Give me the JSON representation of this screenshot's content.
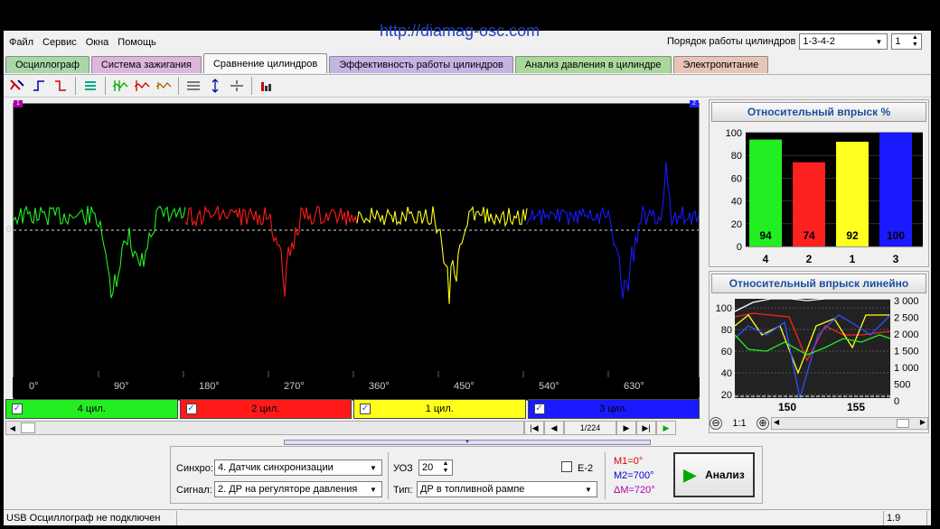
{
  "url_watermark": "http://diamag-osc.com",
  "menu": [
    "Файл",
    "Сервис",
    "Окна",
    "Помощь"
  ],
  "order": {
    "label": "Порядок работы цилиндров",
    "value": "1-3-4-2",
    "count": "1"
  },
  "tabs": [
    {
      "label": "Осциллограф",
      "color": "#a8d8a8"
    },
    {
      "label": "Система зажигания",
      "color": "#dcb6dc"
    },
    {
      "label": "Сравнение цилиндров",
      "color": "#f8f8f8"
    },
    {
      "label": "Эффективность работы цилиндров",
      "color": "#c4b4e4"
    },
    {
      "label": "Анализ давления в цилиндре",
      "color": "#a8d89c"
    },
    {
      "label": "Электропитание",
      "color": "#e8c4b4"
    }
  ],
  "scope": {
    "zero_label": "0",
    "x_ticks": [
      "0°",
      "90°",
      "180°",
      "270°",
      "360°",
      "450°",
      "540°",
      "630°"
    ],
    "marker1": "1",
    "marker2": "2"
  },
  "cylinders": [
    {
      "label": "4 цил.",
      "color": "#22ee22",
      "text_color": "#000"
    },
    {
      "label": "2 цил.",
      "color": "#ff1a1a",
      "text_color": "#000"
    },
    {
      "label": "1 цил.",
      "color": "#ffff1a",
      "text_color": "#000"
    },
    {
      "label": "3 цил.",
      "color": "#1a1aff",
      "text_color": "#000"
    }
  ],
  "nav": {
    "page": "1/224"
  },
  "relative_injection": {
    "title": "Относительный впрыск %",
    "y_ticks": [
      "100",
      "80",
      "60",
      "40",
      "20",
      "0"
    ],
    "chart_data": {
      "type": "bar",
      "categories": [
        "4",
        "2",
        "1",
        "3"
      ],
      "values": [
        94,
        74,
        92,
        100
      ],
      "colors": [
        "#22ee22",
        "#ff2020",
        "#ffff20",
        "#1a1aff"
      ],
      "ylim": [
        0,
        100
      ]
    }
  },
  "linear_injection": {
    "title": "Относительный впрыск линейно",
    "y_left": [
      "100",
      "80",
      "60",
      "40",
      "20"
    ],
    "y_right": [
      "3 000",
      "2 500",
      "2 000",
      "1 500",
      "1 000",
      "500",
      "0"
    ],
    "x_ticks": [
      "150",
      "155"
    ],
    "zoom": "1:1"
  },
  "controls": {
    "sync_label": "Синхро:",
    "sync_value": "4.  Датчик синхронизации",
    "signal_label": "Сигнал:",
    "signal_value": "2.  ДР на регуляторе давления",
    "uoz_label": "УОЗ",
    "uoz_value": "20",
    "type_label": "Тип:",
    "type_value": "ДР в топливной рампе",
    "e2_label": "E-2",
    "m1": "M1=0°",
    "m2": "M2=700°",
    "dm": "ΔM=720°",
    "analyze": "Анализ"
  },
  "status": {
    "left": "USB Осциллограф не подключен",
    "version": "1.9"
  }
}
